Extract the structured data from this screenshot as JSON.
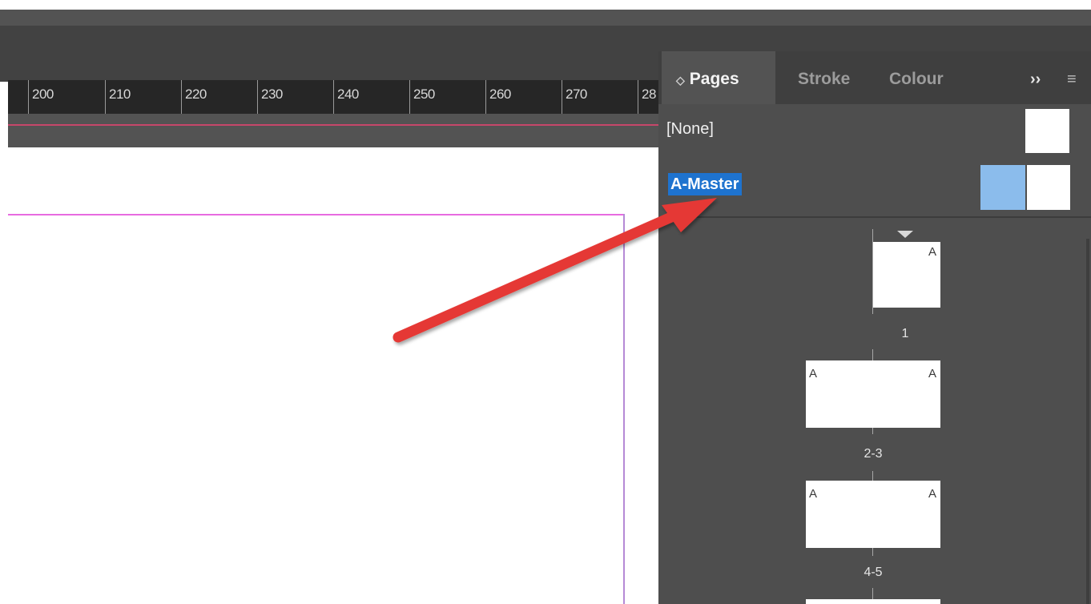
{
  "ruler": {
    "labels": [
      "200",
      "210",
      "220",
      "230",
      "240",
      "250",
      "260",
      "270",
      "28"
    ]
  },
  "panel": {
    "tabs": {
      "pages": "Pages",
      "stroke": "Stroke",
      "colour": "Colour",
      "more": "››",
      "menu": "≡"
    },
    "none_label": "[None]",
    "master_label": "A-Master",
    "pages": [
      {
        "label": "1",
        "left": "",
        "right": "A"
      },
      {
        "label": "2-3",
        "left": "A",
        "right": "A"
      },
      {
        "label": "4-5",
        "left": "A",
        "right": "A"
      }
    ]
  },
  "colors": {
    "selection": "#1e73cf",
    "margin_guide": "#e86be0",
    "arrow": "#e53935"
  }
}
